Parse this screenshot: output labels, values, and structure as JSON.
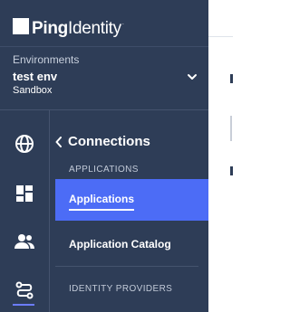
{
  "brand": {
    "name_bold": "Ping",
    "name_regular": "Identity",
    "trademark": "."
  },
  "environment": {
    "label": "Environments",
    "name": "test env",
    "type": "Sandbox"
  },
  "subnav": {
    "back_title": "Connections",
    "sections": [
      {
        "label": "APPLICATIONS",
        "items": [
          {
            "label": "Applications",
            "active": true
          },
          {
            "label": "Application Catalog",
            "active": false
          }
        ]
      },
      {
        "label": "IDENTITY PROVIDERS",
        "items": []
      }
    ]
  },
  "rail": {
    "icons": [
      "globe-icon",
      "dashboard-icon",
      "users-icon",
      "connections-icon"
    ],
    "active": "connections-icon"
  },
  "colors": {
    "sidebar_bg": "#2e3d57",
    "active_item": "#4c6cf6",
    "accent": "#6b7cff"
  }
}
